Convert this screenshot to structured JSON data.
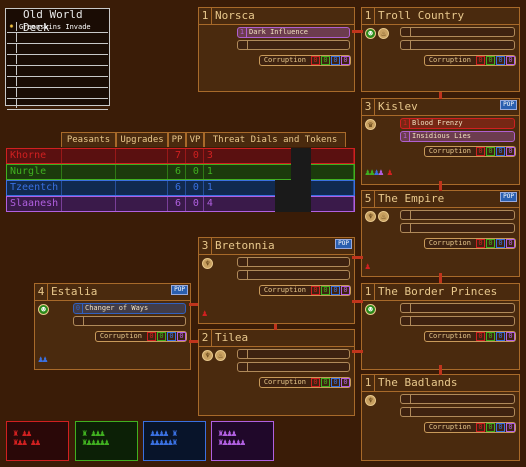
{
  "deck": {
    "title": "Old World Deck",
    "cards": [
      "Greenskins Invade",
      "",
      "",
      "",
      "",
      "",
      "",
      ""
    ]
  },
  "regions": [
    {
      "key": "norsca",
      "num": "1",
      "name": "Norsca",
      "cards": [
        {
          "num": "1",
          "name": "Dark Influence",
          "color": "#b060d0"
        }
      ],
      "corruption": "Corruption",
      "c": [
        "0",
        "0",
        "0",
        "0"
      ],
      "pop": false,
      "tokens": []
    },
    {
      "key": "troll",
      "num": "1",
      "name": "Troll Country",
      "cards": [],
      "corruption": "Corruption",
      "c": [
        "0",
        "0",
        "0",
        "0"
      ],
      "pop": false,
      "tokens": [
        "ork-icon",
        "chalice-icon"
      ]
    },
    {
      "key": "kislev",
      "num": "3",
      "name": "Kislev",
      "cards": [
        {
          "num": "1",
          "name": "Blood Frenzy",
          "color": "#d02020"
        },
        {
          "num": "1",
          "name": "Insidious Lies",
          "color": "#b060d0"
        }
      ],
      "corruption": "Corruption",
      "c": [
        "0",
        "0",
        "0",
        "0"
      ],
      "pop": true,
      "tokens": [
        "crown-icon"
      ]
    },
    {
      "key": "empire",
      "num": "5",
      "name": "The Empire",
      "cards": [],
      "corruption": "Corruption",
      "c": [
        "0",
        "0",
        "0",
        "0"
      ],
      "pop": true,
      "tokens": [
        "wheat-icon",
        "chalice-icon"
      ]
    },
    {
      "key": "bretonnia",
      "num": "3",
      "name": "Bretonnia",
      "cards": [],
      "corruption": "Corruption",
      "c": [
        "0",
        "0",
        "0",
        "0"
      ],
      "pop": true,
      "tokens": [
        "wheat-icon"
      ]
    },
    {
      "key": "border",
      "num": "1",
      "name": "The Border Princes",
      "cards": [],
      "corruption": "Corruption",
      "c": [
        "0",
        "0",
        "0",
        "0"
      ],
      "pop": false,
      "tokens": [
        "ork-icon"
      ]
    },
    {
      "key": "estalia",
      "num": "4",
      "name": "Estalia",
      "cards": [
        {
          "num": "0",
          "name": "Changer of Ways",
          "color": "#3060c0"
        }
      ],
      "corruption": "Corruption",
      "c": [
        "0",
        "0",
        "0",
        "0"
      ],
      "pop": true,
      "tokens": [
        "ork-icon"
      ]
    },
    {
      "key": "tilea",
      "num": "2",
      "name": "Tilea",
      "cards": [],
      "corruption": "Corruption",
      "c": [
        "0",
        "0",
        "0",
        "0"
      ],
      "pop": false,
      "tokens": [
        "wheat-icon",
        "chalice-icon"
      ]
    },
    {
      "key": "badlands",
      "num": "1",
      "name": "The Badlands",
      "cards": [],
      "corruption": "Corruption",
      "c": [
        "0",
        "0",
        "0",
        "0"
      ],
      "pop": false,
      "tokens": [
        "wheat-icon"
      ]
    }
  ],
  "table": {
    "headers": [
      "Peasants",
      "Upgrades",
      "PP",
      "VP",
      "Threat Dials and Tokens"
    ],
    "rows": [
      {
        "name": "Khorne",
        "pp": "7",
        "vp": "0",
        "threat": "3",
        "color": "#d02020",
        "bg": "#5a1010"
      },
      {
        "name": "Nurgle",
        "pp": "6",
        "vp": "0",
        "threat": "1",
        "color": "#40b020",
        "bg": "#1c3a0c"
      },
      {
        "name": "Tzeentch",
        "pp": "6",
        "vp": "0",
        "threat": "1",
        "color": "#3a70e0",
        "bg": "#102a50"
      },
      {
        "name": "Slaanesh",
        "pp": "6",
        "vp": "0",
        "threat": "4",
        "color": "#b060e0",
        "bg": "#3a1a4a"
      }
    ]
  },
  "colors": {
    "corruption": [
      "#d02020",
      "#40b020",
      "#3a70e0",
      "#b060e0"
    ],
    "pop": "POP"
  }
}
